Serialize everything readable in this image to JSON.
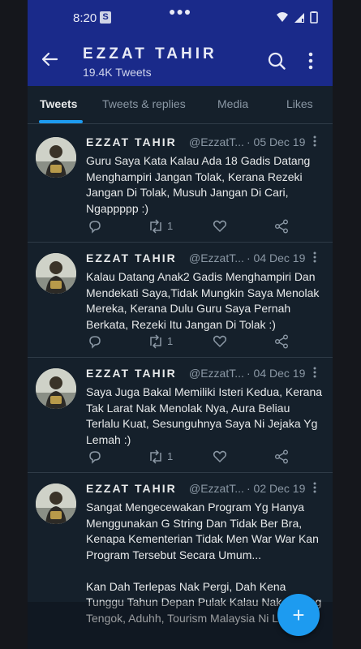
{
  "status_bar": {
    "time": "8:20",
    "badge": "S"
  },
  "header": {
    "name": "EZZAT TAHIR",
    "tweet_count": "19.4K Tweets"
  },
  "tabs": [
    {
      "label": "Tweets"
    },
    {
      "label": "Tweets & replies"
    },
    {
      "label": "Media"
    },
    {
      "label": "Likes"
    }
  ],
  "tweets": [
    {
      "name": "EZZAT TAHIR",
      "handle": "@EzzatT...",
      "date": "· 05 Dec 19",
      "text": "Guru Saya Kata Kalau Ada 18 Gadis Datang Menghampiri Jangan Tolak, Kerana Rezeki Jangan Di Tolak, Musuh Jangan Di Cari, Ngappppp :)",
      "retweets": "1"
    },
    {
      "name": "EZZAT TAHIR",
      "handle": "@EzzatT...",
      "date": "· 04 Dec 19",
      "text": "Kalau Datang Anak2 Gadis Menghampiri Dan Mendekati Saya,Tidak Mungkin Saya Menolak Mereka, Kerana Dulu Guru Saya Pernah Berkata, Rezeki Itu Jangan Di Tolak :)",
      "retweets": "1"
    },
    {
      "name": "EZZAT TAHIR",
      "handle": "@EzzatT...",
      "date": "· 04 Dec 19",
      "text": "Saya Juga Bakal Memiliki Isteri Kedua, Kerana Tak Larat Nak Menolak Nya, Aura Beliau Terlalu Kuat, Sesunguhnya Saya Ni Jejaka Yg Lemah :)",
      "retweets": "1"
    },
    {
      "name": "EZZAT TAHIR",
      "handle": "@EzzatT...",
      "date": "· 02 Dec 19",
      "text": "Sangat Mengecewakan Program Yg Hanya Menggunakan G String Dan Tidak Ber Bra, Kenapa Kementerian Tidak Men War War Kan Program Tersebut Secara Umum...\n\nKan Dah Terlepas Nak Pergi, Dah Kena Tunggu Tahun Depan Pulak Kalau Nak Datang Tengok, Aduhh, Tourism Malaysia Ni Lah :)",
      "retweets": ""
    }
  ],
  "colors": {
    "header_bg": "#1a2a8a",
    "page_bg": "#15202b",
    "accent": "#1d9bf0"
  },
  "icons": [
    "back-arrow-icon",
    "search-icon",
    "more-icon",
    "reply-icon",
    "retweet-icon",
    "like-icon",
    "share-icon",
    "compose-plus-icon"
  ]
}
